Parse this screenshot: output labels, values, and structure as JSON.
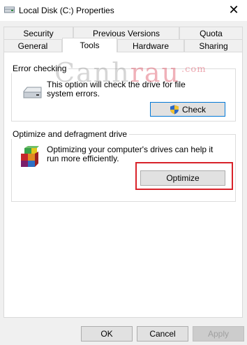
{
  "window": {
    "title": "Local Disk (C:) Properties",
    "close_glyph": "✕"
  },
  "tabs": {
    "row1": [
      "Security",
      "Previous Versions",
      "Quota"
    ],
    "row2": [
      "General",
      "Tools",
      "Hardware",
      "Sharing"
    ],
    "active": "Tools"
  },
  "error_checking": {
    "title": "Error checking",
    "description": "This option will check the drive for file system errors.",
    "button_label": "Check",
    "icon": "drive-icon",
    "button_icon": "uac-shield-icon"
  },
  "optimize": {
    "title": "Optimize and defragment drive",
    "description": "Optimizing your computer's drives can help it run more efficiently.",
    "button_label": "Optimize",
    "icon": "defrag-icon",
    "highlight_color": "#d8222a"
  },
  "footer": {
    "ok": "OK",
    "cancel": "Cancel",
    "apply": "Apply"
  },
  "watermark": {
    "part1": "Canh",
    "part2": "rau",
    "suffix": ".com"
  }
}
